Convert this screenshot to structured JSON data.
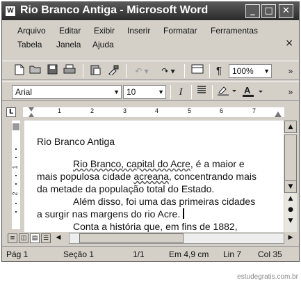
{
  "window": {
    "title": "Rio Branco Antiga - Microsoft Word",
    "app_icon": "W",
    "minimize_label": "_",
    "maximize_label": "□",
    "close_label": "✕"
  },
  "menus": {
    "row1": [
      "Arquivo",
      "Editar",
      "Exibir",
      "Inserir",
      "Formatar",
      "Ferramentas"
    ],
    "row2": [
      "Tabela",
      "Janela",
      "Ajuda"
    ],
    "doc_close": "×"
  },
  "toolbar_standard": {
    "zoom": "100%",
    "icons": [
      "new-document-icon",
      "open-icon",
      "save-icon",
      "print-icon",
      "paste-icon",
      "format-painter-icon",
      "undo-icon",
      "redo-icon",
      "table-icon",
      "paragraph-marks-icon"
    ],
    "paragraph_mark": "¶",
    "more": "»"
  },
  "toolbar_formatting": {
    "font": "Arial",
    "size": "10",
    "italic_label": "I",
    "more": "»"
  },
  "ruler": {
    "numbers": [
      "1",
      "2",
      "3",
      "4",
      "5",
      "6",
      "7"
    ],
    "tab_selector": "L"
  },
  "vruler": {
    "numbers": [
      "1",
      "2"
    ]
  },
  "document": {
    "title": "Rio Branco Antiga",
    "lines": [
      {
        "prefix": "",
        "underlined": "Rio Branco, capital do Acre",
        "text": ", é a maior e",
        "indent": true
      },
      {
        "prefix": "mais populosa cidade ",
        "underlined": "acreana",
        "text": ", concentrando mais",
        "indent": false
      },
      {
        "prefix": "",
        "underlined": "",
        "text": "da metade da população total do Estado.",
        "indent": false
      },
      {
        "prefix": "",
        "underlined": "",
        "text": "Além disso, foi uma das primeiras cidades",
        "indent": true
      },
      {
        "prefix": "",
        "underlined": "",
        "text": "a surgir nas margens do rio Acre.",
        "indent": false,
        "cursor": true
      },
      {
        "prefix": "",
        "underlined": "",
        "text": "Conta a história que, em fins de 1882,",
        "indent": true
      }
    ]
  },
  "statusbar": {
    "page": "Pág  1",
    "section": "Seção  1",
    "pages": "1/1",
    "position": "Em  4,9 cm",
    "line": "Lin  7",
    "column": "Col  35"
  },
  "watermark": "estudegratis.com.br",
  "colors": {
    "titlebar": "#3a3a3a",
    "chrome": "#d4d0c8"
  }
}
